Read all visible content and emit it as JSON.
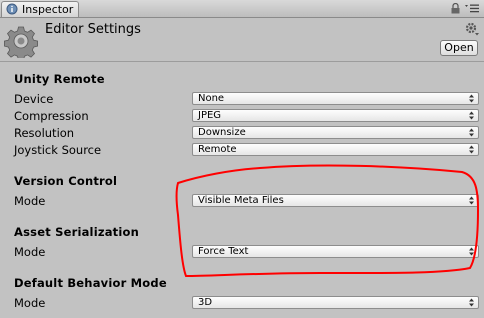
{
  "tab": {
    "label": "Inspector"
  },
  "header": {
    "title": "Editor Settings",
    "open_label": "Open"
  },
  "sections": {
    "unity_remote": {
      "title": "Unity Remote",
      "device_label": "Device",
      "device_value": "None",
      "compression_label": "Compression",
      "compression_value": "JPEG",
      "resolution_label": "Resolution",
      "resolution_value": "Downsize",
      "joystick_label": "Joystick Source",
      "joystick_value": "Remote"
    },
    "version_control": {
      "title": "Version Control",
      "mode_label": "Mode",
      "mode_value": "Visible Meta Files"
    },
    "asset_serialization": {
      "title": "Asset Serialization",
      "mode_label": "Mode",
      "mode_value": "Force Text"
    },
    "default_behavior": {
      "title": "Default Behavior Mode",
      "mode_label": "Mode",
      "mode_value": "3D"
    }
  },
  "annotation": {
    "color": "#ff0000"
  }
}
